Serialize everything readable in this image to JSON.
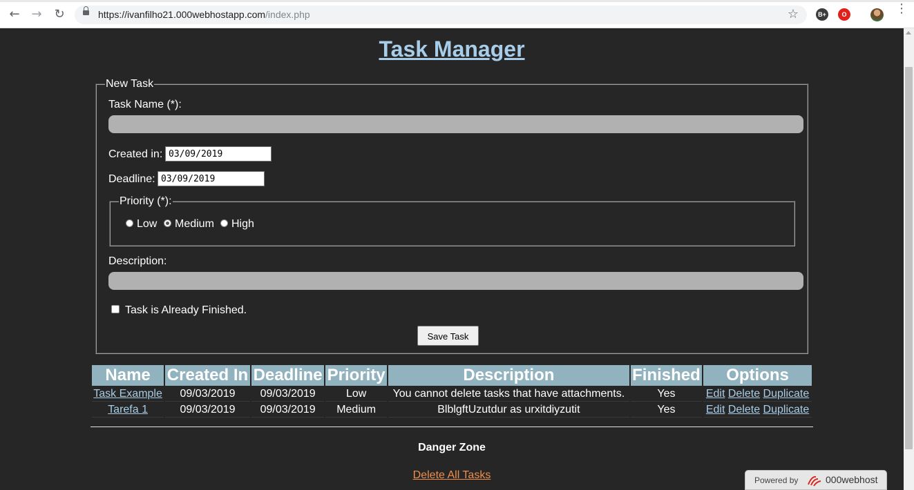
{
  "browser": {
    "url_host": "https://ivanfilho21.000webhostapp.com",
    "url_path": "/index.php",
    "ext_b_label": "B+"
  },
  "page": {
    "title": "Task Manager"
  },
  "form": {
    "legend": "New Task",
    "task_name_label": "Task Name (*):",
    "created_label": "Created in:",
    "created_value": "03/09/2019",
    "deadline_label": "Deadline:",
    "deadline_value": "03/09/2019",
    "priority_legend": "Priority (*):",
    "priority_options": [
      "Low",
      "Medium",
      "High"
    ],
    "priority_selected": "Medium",
    "description_label": "Description:",
    "finished_label": "Task is Already Finished.",
    "save_label": "Save Task"
  },
  "table": {
    "headers": [
      "Name",
      "Created In",
      "Deadline",
      "Priority",
      "Description",
      "Finished",
      "Options"
    ],
    "rows": [
      {
        "name": "Task Example",
        "created": "09/03/2019",
        "deadline": "09/03/2019",
        "priority": "Low",
        "description": "You cannot delete tasks that have attachments.",
        "finished": "Yes"
      },
      {
        "name": "Tarefa 1",
        "created": "09/03/2019",
        "deadline": "09/03/2019",
        "priority": "Medium",
        "description": "BlblgftUzutdur as urxitdiyzutit",
        "finished": "Yes"
      }
    ],
    "options": {
      "edit": "Edit",
      "delete": "Delete",
      "duplicate": "Duplicate"
    }
  },
  "danger": {
    "heading": "Danger Zone",
    "delete_all": "Delete All Tasks"
  },
  "footer": {
    "powered_by": "Powered by",
    "brand": "000webhost"
  }
}
